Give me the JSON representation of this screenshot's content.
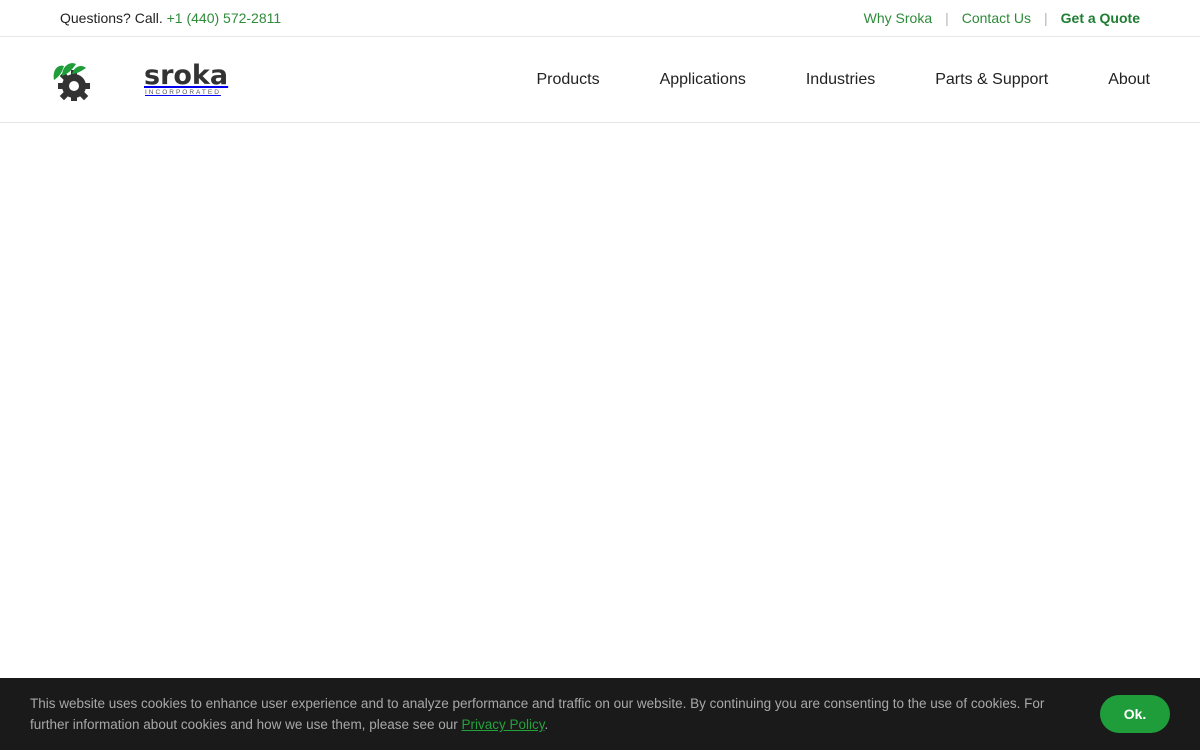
{
  "topbar": {
    "questions_label": "Questions? Call.",
    "phone": "+1 (440) 572-2811",
    "links": [
      {
        "label": "Why Sroka"
      },
      {
        "label": "Contact Us"
      },
      {
        "label": "Get a Quote"
      }
    ],
    "separator": "|"
  },
  "brand": {
    "name": "sroka",
    "tagline": "INCORPORATED",
    "colors": {
      "green": "#1f9d3a",
      "dark": "#333333"
    }
  },
  "nav": {
    "items": [
      {
        "label": "Products"
      },
      {
        "label": "Applications"
      },
      {
        "label": "Industries"
      },
      {
        "label": "Parts & Support"
      },
      {
        "label": "About"
      }
    ]
  },
  "cookie": {
    "text_before": "This website uses cookies to enhance user experience and to analyze performance and traffic on our website. By continuing you are consenting to the use of cookies. For further information about cookies and how we use them, please see our ",
    "link_label": "Privacy Policy",
    "text_after": ".",
    "ok_label": "Ok."
  },
  "colors": {
    "accent": "#2e8b3a",
    "cookie_bg": "#1a1a1a",
    "button": "#1f9d3a"
  }
}
